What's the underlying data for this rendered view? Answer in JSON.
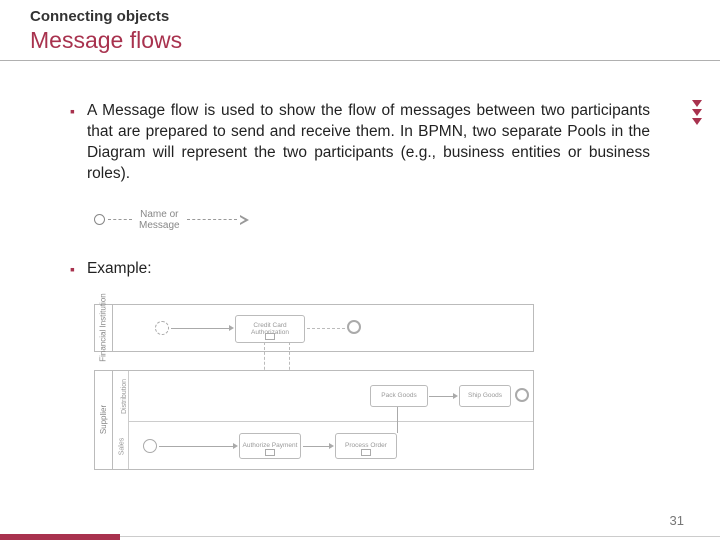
{
  "header": {
    "overline": "Connecting objects",
    "title": "Message flows"
  },
  "bullets": {
    "b1": "A Message flow is used to show the flow of messages between two participants that are prepared to send and receive them. In BPMN, two separate Pools in the Diagram will represent the two participants (e.g., business entities or business roles).",
    "b2": "Example:"
  },
  "msgflow": {
    "labelL1": "Name or",
    "labelL2": "Message"
  },
  "diagram": {
    "pool1": "Financial Institution",
    "pool2": "Supplier",
    "lane1": "Distribution",
    "lane2": "Sales",
    "task_auth": "Credit Card Authorization",
    "task_pack": "Pack Goods",
    "task_ship": "Ship Goods",
    "task_authpay": "Authorize Payment",
    "task_process": "Process Order"
  },
  "page": "31"
}
